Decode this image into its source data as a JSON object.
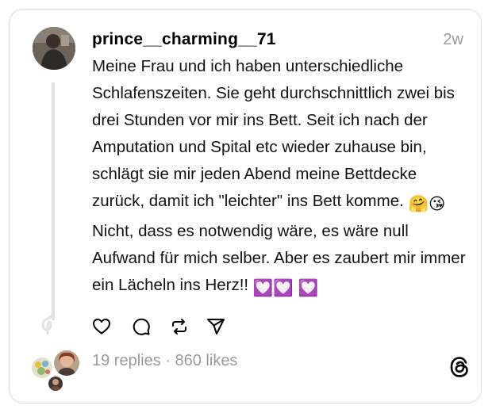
{
  "post": {
    "username": "prince__charming__71",
    "time": "2w",
    "text": {
      "part1": "Meine Frau und ich haben unterschiedliche Schlafenszeiten. Sie geht durchschnittlich zwei bis drei Stunden vor mir ins Bett. Seit ich nach der Amputation und Spital etc wieder zuhause bin, schlägt sie mir jeden Abend meine Bettdecke zurück, damit ich \"leichter\" ins Bett komme. ",
      "emoji1": "🤗",
      "emoji2": "😘",
      "part2": "Nicht, dass es notwendig wäre, es wäre null Aufwand für mich selber. Aber es zaubert mir immer ein Lächeln ins Herz!! ",
      "emoji3": "💟",
      "emoji4": "💟",
      "emoji5": "💟"
    },
    "actions": [
      "heart-icon",
      "comment-icon",
      "repost-icon",
      "share-icon"
    ]
  },
  "footer": {
    "replies": "19 replies",
    "separator": " · ",
    "likes": "860 likes",
    "logo": "threads-logo-icon"
  },
  "colors": {
    "border": "#d9d9d9",
    "muted": "#9a9a9a",
    "thread_line": "#e2e2e2",
    "heart_emoji": "#b44fd1"
  }
}
